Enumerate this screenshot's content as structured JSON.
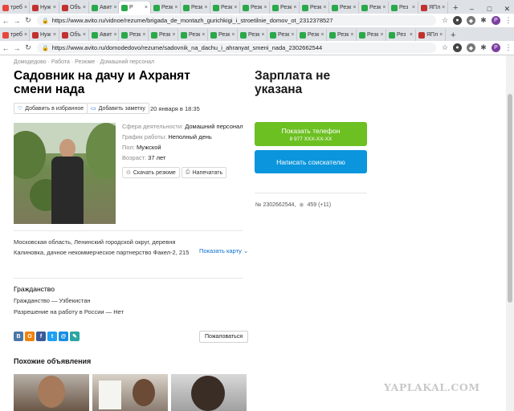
{
  "browser": {
    "tabs_row1": [
      {
        "label": "треб",
        "color": "#e8453c"
      },
      {
        "label": "Нуж",
        "color": "#c0312f"
      },
      {
        "label": "Объ",
        "color": "#c0312f"
      },
      {
        "label": "Авит",
        "color": "#2aa84a"
      },
      {
        "label": "Р",
        "color": "#2aa84a"
      },
      {
        "label": "Резк",
        "color": "#2aa84a"
      },
      {
        "label": "Резк",
        "color": "#2aa84a"
      },
      {
        "label": "Резк",
        "color": "#2aa84a"
      },
      {
        "label": "Резк",
        "color": "#2aa84a"
      },
      {
        "label": "Резк",
        "color": "#2aa84a"
      },
      {
        "label": "Резк",
        "color": "#2aa84a"
      },
      {
        "label": "Резк",
        "color": "#2aa84a"
      },
      {
        "label": "Резк",
        "color": "#2aa84a"
      },
      {
        "label": "Рез",
        "color": "#2aa84a"
      },
      {
        "label": "ЯПл",
        "color": "#c0312f"
      }
    ],
    "tabs_row2": [
      {
        "label": "треб",
        "color": "#e8453c"
      },
      {
        "label": "Нуж",
        "color": "#c0312f"
      },
      {
        "label": "Объ",
        "color": "#c0312f"
      },
      {
        "label": "Авит",
        "color": "#2aa84a"
      },
      {
        "label": "Резк",
        "color": "#2aa84a"
      },
      {
        "label": "Резк",
        "color": "#2aa84a"
      },
      {
        "label": "Резк",
        "color": "#2aa84a"
      },
      {
        "label": "Резк",
        "color": "#2aa84a"
      },
      {
        "label": "Резк",
        "color": "#2aa84a"
      },
      {
        "label": "Резк",
        "color": "#2aa84a"
      },
      {
        "label": "Резк",
        "color": "#2aa84a"
      },
      {
        "label": "Резк",
        "color": "#2aa84a"
      },
      {
        "label": "Резк",
        "color": "#2aa84a"
      },
      {
        "label": "Рез",
        "color": "#2aa84a"
      },
      {
        "label": "ЯПл",
        "color": "#c0312f"
      }
    ],
    "url1": "https://www.avito.ru/vidnoe/rezume/brigada_de_montazh_gurichkigi_i_stroetilnie_domov_ot_2312378527",
    "url2": "https://www.avito.ru/domodedovo/rezume/sadovnik_na_dachu_i_ahranyat_smeni_nada_2302662544",
    "profile_letter": "P"
  },
  "page": {
    "breadcrumb": "Домодедово · Работа · Резюме · Домашний персонал",
    "title": "Садовник на дачу и Ахранят смени нада",
    "salary": "Зарплата не указана",
    "favorite_label": "Добавить в избранное",
    "note_label": "Добавить заметку",
    "date": "20 января в 18:35",
    "fields": [
      {
        "key": "Сфера деятельности:",
        "value": "Домашний персонал"
      },
      {
        "key": "График работы:",
        "value": "Неполный день"
      },
      {
        "key": "Пол:",
        "value": "Мужской"
      },
      {
        "key": "Возраст:",
        "value": "37 лет"
      }
    ],
    "download_label": "Скачать резюме",
    "print_label": "Напечатать",
    "address": "Московская область, Ленинский городской округ, деревня Калиновка, дачное некоммерческое партнерство Факел-2, 215",
    "show_map": "Показать карту",
    "citizenship_heading": "Гражданство",
    "citizenship_line": "Гражданство — Узбекистан",
    "work_permit_line": "Разрешение на работу в России — Нет",
    "complain_label": "Пожаловаться",
    "similar_heading": "Похожие объявления",
    "show_phone": "Показать телефон",
    "phone_masked": "8 977 XXX-XX-XX",
    "write_label": "Написать соискателю",
    "ad_number": "№ 2302662544,",
    "views": "459 (+11)",
    "watermark": "YAPLAKAL.COM"
  },
  "colors": {
    "green_button": "#6cc022",
    "blue_button": "#0a95dc",
    "link": "#0a6fcd"
  }
}
